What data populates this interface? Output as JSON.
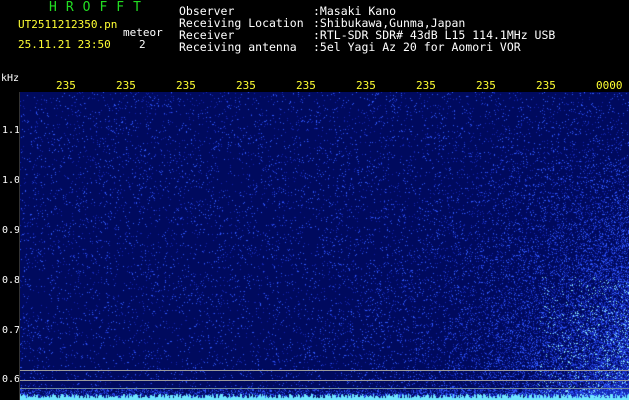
{
  "header": {
    "app_title": "HROFFT",
    "file_name": "UT2511212350.pn",
    "datetime": "25.11.21 23:50",
    "meteor_label": "meteor",
    "meteor_count": "2",
    "info": [
      {
        "label": "Observer",
        "value": ":Masaki Kano"
      },
      {
        "label": "Receiving Location",
        "value": ":Shibukawa,Gunma,Japan"
      },
      {
        "label": "Receiver",
        "value": ":RTL-SDR SDR# 43dB L15 114.1MHz USB"
      },
      {
        "label": "Receiving antenna",
        "value": ":5el Yagi Az 20 for Aomori VOR"
      }
    ]
  },
  "axes": {
    "y_unit": "kHz",
    "y_ticks": [
      "1.1",
      "1.0",
      "0.9",
      "0.8",
      "0.7",
      "0.6"
    ],
    "x_ticks": [
      "235",
      "235",
      "235",
      "235",
      "235",
      "235",
      "235",
      "235",
      "235",
      "0000"
    ]
  },
  "colors": {
    "background": "#000000",
    "spectrogram_bg": "#000a5e",
    "title_green": "#22dd22",
    "yellow_text": "#ffff33",
    "white_text": "#ffffff",
    "noise_blue": "#2f4cff",
    "noise_cyan": "#6fe6ff"
  }
}
